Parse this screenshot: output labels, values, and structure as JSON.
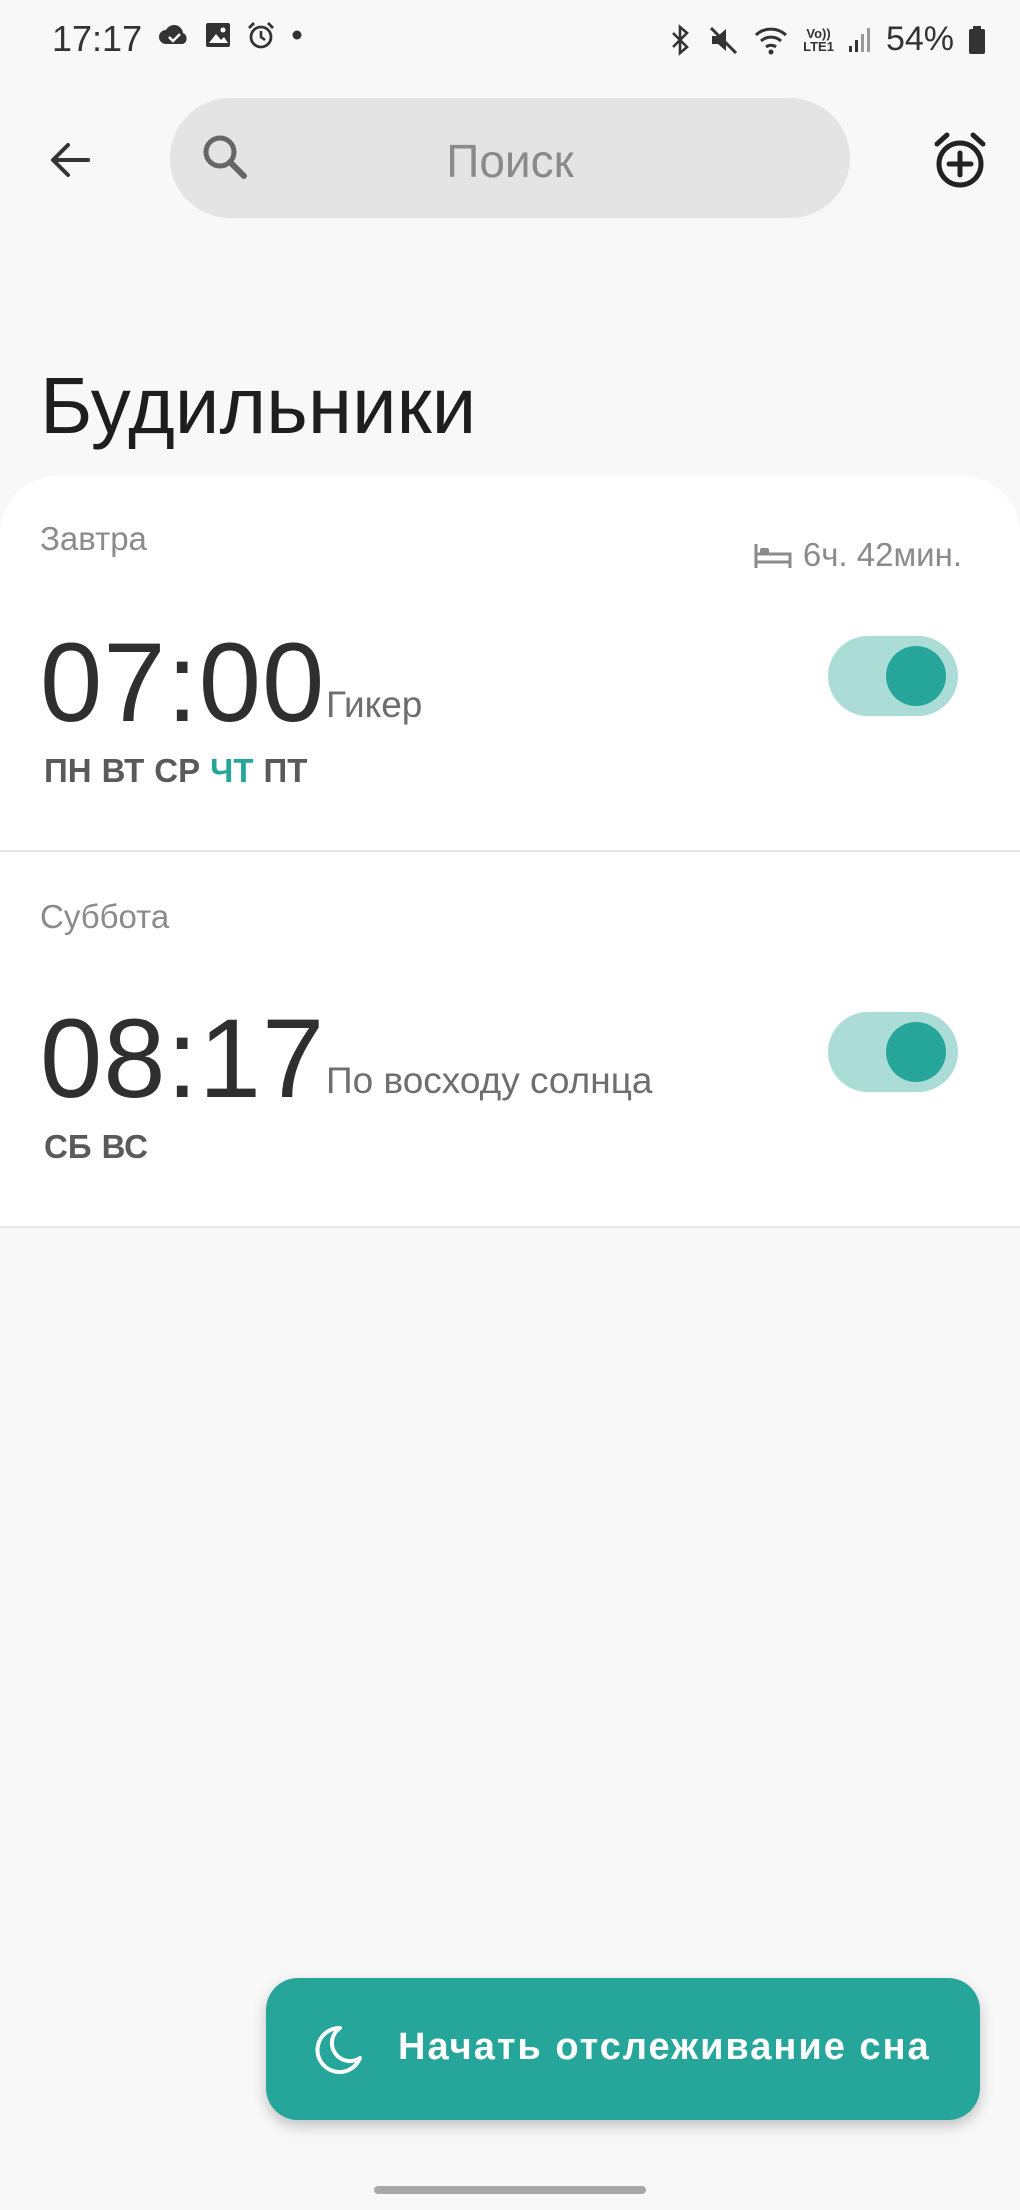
{
  "status_bar": {
    "time": "17:17",
    "lte_top": "Vo))",
    "lte_bottom": "LTE1",
    "battery": "54%",
    "left_icons": [
      "cloud-check-icon",
      "image-icon",
      "alarm-clock-icon",
      "dot-icon"
    ],
    "right_icons": [
      "bluetooth-icon",
      "mute-icon",
      "wifi-icon",
      "signal-icon",
      "battery-icon"
    ]
  },
  "toolbar": {
    "search_placeholder": "Поиск",
    "back_icon": "arrow-left-icon",
    "add_icon": "add-alarm-icon"
  },
  "page": {
    "title": "Будильники"
  },
  "alarms": [
    {
      "day_label": "Завтра",
      "sleep_duration": "6ч. 42мин.",
      "time": "07:00",
      "name": "Гикер",
      "days": [
        "ПН",
        "ВТ",
        "СР",
        "ЧТ",
        "ПТ"
      ],
      "highlighted_day": "ЧТ",
      "enabled": true
    },
    {
      "day_label": "Суббота",
      "time": "08:17",
      "name": "По восходу солнца",
      "days": [
        "СБ",
        "ВС"
      ],
      "enabled": true
    }
  ],
  "sleep_button": {
    "label": "Начать отслеживание сна",
    "icon": "moon-icon"
  },
  "colors": {
    "accent": "#26a69a",
    "toggle_track": "#abdcd6",
    "background": "#f8f8f8"
  }
}
